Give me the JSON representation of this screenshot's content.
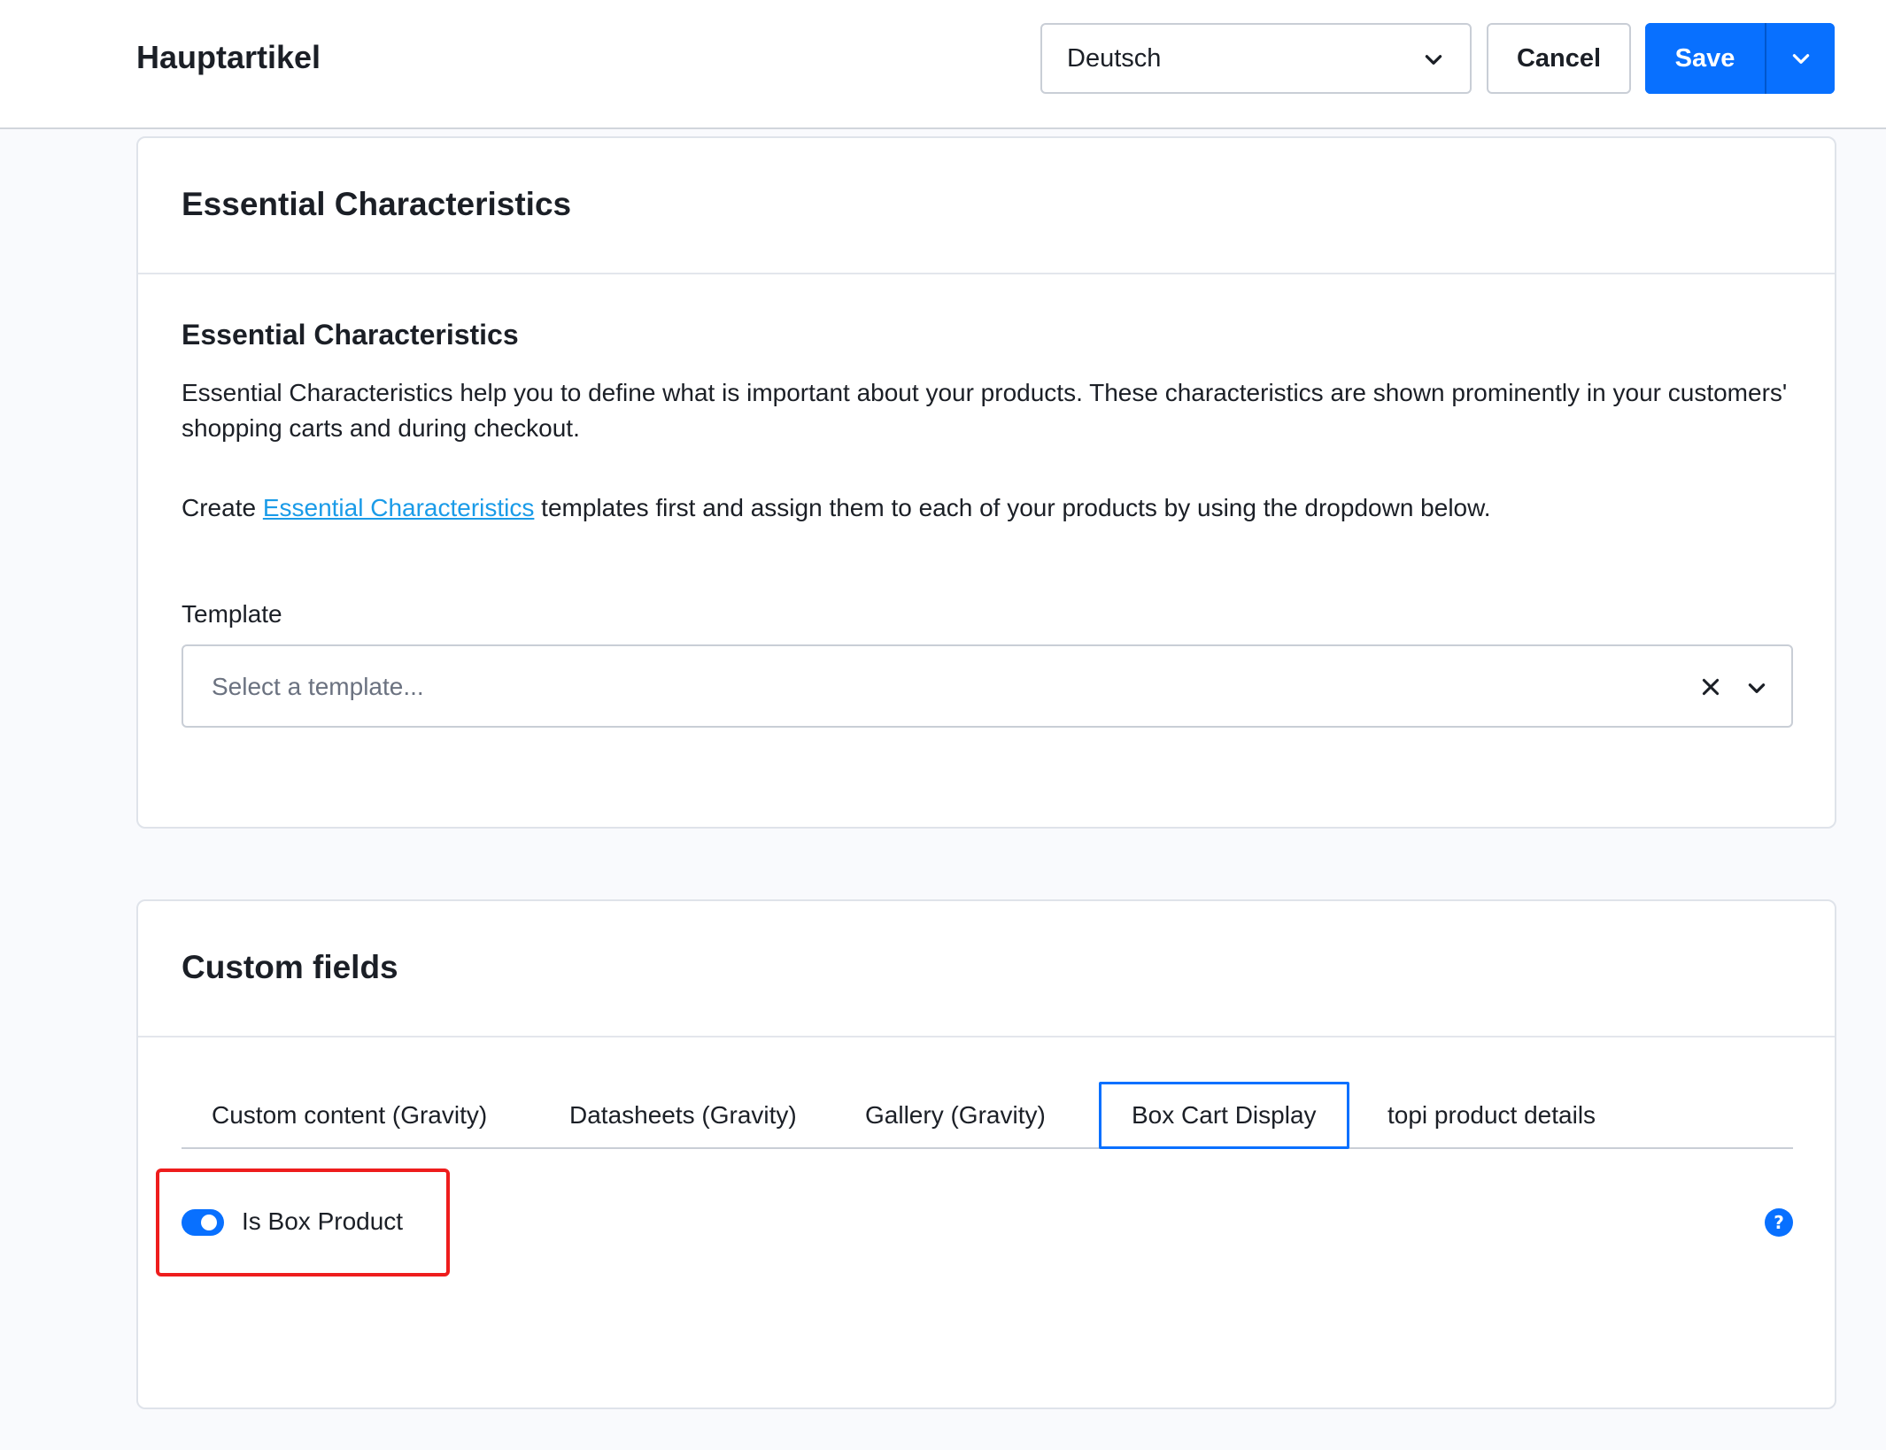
{
  "header": {
    "title": "Hauptartikel",
    "language_select": {
      "value": "Deutsch"
    },
    "cancel_label": "Cancel",
    "save_label": "Save"
  },
  "essential_card": {
    "header_title": "Essential Characteristics",
    "section_title": "Essential Characteristics",
    "description": "Essential Characteristics help you to define what is important about your products. These characteristics are shown prominently in your customers' shopping carts and during checkout.",
    "create_prefix": "Create ",
    "create_link": "Essential Characteristics",
    "create_suffix": " templates first and assign them to each of your products by using the dropdown below.",
    "template_label": "Template",
    "template_placeholder": "Select a template..."
  },
  "custom_fields_card": {
    "header_title": "Custom fields",
    "tabs": [
      {
        "label": "Custom content (Gravity)",
        "active": false
      },
      {
        "label": "Datasheets (Gravity)",
        "active": false
      },
      {
        "label": "Gallery (Gravity)",
        "active": false
      },
      {
        "label": "Box Cart Display",
        "active": true
      },
      {
        "label": "topi product details",
        "active": false
      }
    ],
    "toggle": {
      "label": "Is Box Product",
      "checked": true
    },
    "help_glyph": "?"
  },
  "colors": {
    "accent": "#0870ff",
    "link": "#1a9be8",
    "highlight": "#ee1d1d"
  }
}
